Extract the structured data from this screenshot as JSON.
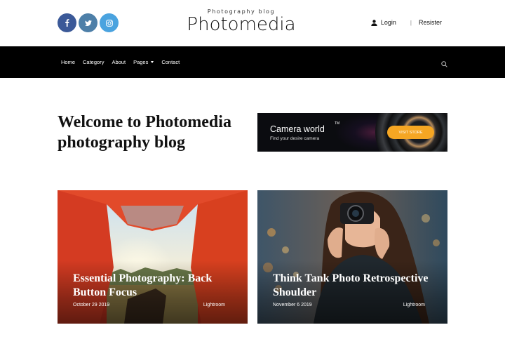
{
  "header": {
    "social": [
      {
        "icon": "facebook-icon",
        "color": "#3b5998"
      },
      {
        "icon": "twitter-icon",
        "color": "#4d7fa8"
      },
      {
        "icon": "instagram-icon",
        "color": "#4aa3df"
      }
    ],
    "tagline": "Photography blog",
    "title": "Photomedia",
    "login_label": "Login",
    "separator": "|",
    "register_label": "Resister"
  },
  "nav": {
    "items": [
      "Home",
      "Category",
      "About",
      "Pages",
      "Contact"
    ],
    "background": "#000000"
  },
  "hero": {
    "heading": "Welcome to Photomedia photography blog",
    "banner": {
      "title": "Camera world",
      "subtitle": "Find your desire camera",
      "tm": "TM",
      "button_label": "VISIT STORE",
      "button_color": "#f5a623"
    }
  },
  "posts": [
    {
      "title": "Essential Photography: Back Button Focus",
      "date": "October 29 2019",
      "category": "Lightroom"
    },
    {
      "title": "Think Tank Photo Retrospective Shoulder",
      "date": "November 6 2019",
      "category": "Lightroom"
    }
  ]
}
